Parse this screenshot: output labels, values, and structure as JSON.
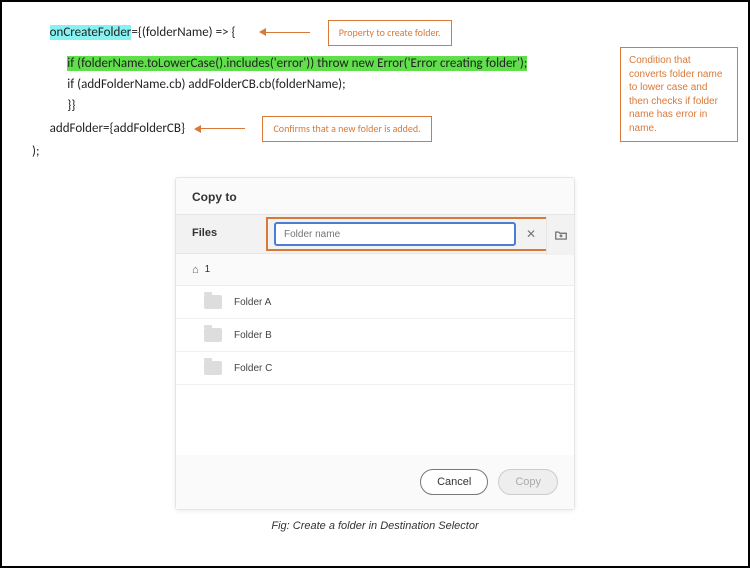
{
  "code": {
    "line1_hl": "onCreateFolder",
    "line1_rest": "={(folderName) => {",
    "line2": "if (folderName.toLowerCase().includes('error')) throw new Error('Error creating folder');",
    "line3": "if (addFolderName.cb) addFolderCB.cb(folderName);",
    "line4": "}}",
    "line5": "addFolder={addFolderCB}",
    "line6": ");"
  },
  "callouts": {
    "property": "Property to create folder.",
    "confirm": "Confirms that a new folder is added.",
    "condition": "Condition that converts folder name to lower case and then checks if folder name has error in name."
  },
  "dialog": {
    "title": "Copy to",
    "files_label": "Files",
    "path_label": "1",
    "input_placeholder": "Folder name",
    "folders": [
      "Folder A",
      "Folder B",
      "Folder C"
    ],
    "cancel": "Cancel",
    "copy": "Copy"
  },
  "caption": "Fig: Create a folder in Destination Selector"
}
